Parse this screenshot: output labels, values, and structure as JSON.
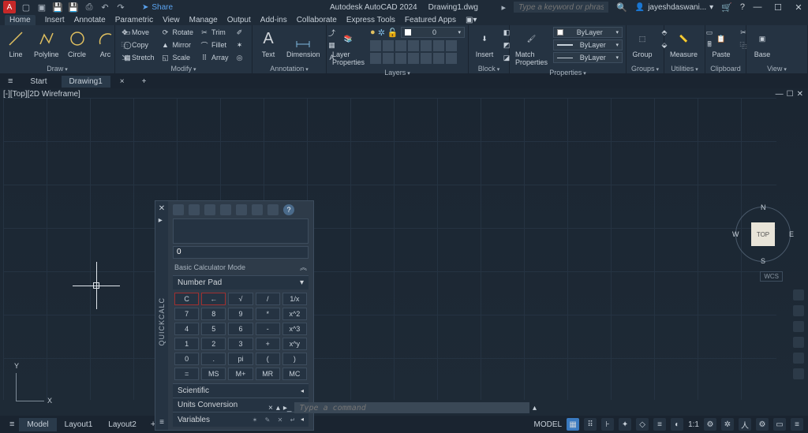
{
  "title": {
    "app": "Autodesk AutoCAD 2024",
    "file": "Drawing1.dwg"
  },
  "qat_share": "Share",
  "search_placeholder": "Type a keyword or phrase",
  "user": "jayeshdaswani...",
  "menu_tabs": [
    "Home",
    "Insert",
    "Annotate",
    "Parametric",
    "View",
    "Manage",
    "Output",
    "Add-ins",
    "Collaborate",
    "Express Tools",
    "Featured Apps"
  ],
  "ribbon": {
    "draw": {
      "label": "Draw",
      "line": "Line",
      "polyline": "Polyline",
      "circle": "Circle",
      "arc": "Arc"
    },
    "modify": {
      "label": "Modify",
      "move": "Move",
      "copy": "Copy",
      "stretch": "Stretch",
      "rotate": "Rotate",
      "mirror": "Mirror",
      "scale": "Scale",
      "trim": "Trim",
      "fillet": "Fillet",
      "array": "Array"
    },
    "annotation": {
      "label": "Annotation",
      "text": "Text",
      "dimension": "Dimension"
    },
    "layers": {
      "label": "Layers",
      "props": "Layer\nProperties",
      "layer0": "0"
    },
    "block": {
      "label": "Block",
      "insert": "Insert"
    },
    "properties": {
      "label": "Properties",
      "match": "Match\nProperties",
      "bylayer": "ByLayer"
    },
    "groups": {
      "label": "Groups",
      "group": "Group"
    },
    "utilities": {
      "label": "Utilities",
      "measure": "Measure"
    },
    "clipboard": {
      "label": "Clipboard",
      "paste": "Paste"
    },
    "view": {
      "label": "View",
      "base": "Base"
    }
  },
  "doc_tabs": {
    "start": "Start",
    "drawing": "Drawing1"
  },
  "viewport": {
    "label": "[-][Top][2D Wireframe]",
    "cube_face": "TOP",
    "cube_n": "N",
    "cube_s": "S",
    "cube_e": "E",
    "cube_w": "W",
    "wcs": "WCS",
    "ucs_x": "X",
    "ucs_y": "Y"
  },
  "quickcalc": {
    "title": "QUICKCALC",
    "result": "0",
    "mode": "Basic Calculator Mode",
    "section_numpad": "Number Pad",
    "section_sci": "Scientific",
    "section_units": "Units Conversion",
    "section_vars": "Variables",
    "keys": [
      "C",
      "←",
      "√",
      "/",
      "1/x",
      "7",
      "8",
      "9",
      "*",
      "x^2",
      "4",
      "5",
      "6",
      "-",
      "x^3",
      "1",
      "2",
      "3",
      "+",
      "x^y",
      "0",
      ".",
      "pi",
      "(",
      ")",
      "=",
      "MS",
      "M+",
      "MR",
      "MC"
    ]
  },
  "cmd_placeholder": "Type a command",
  "bottom_tabs": {
    "model": "Model",
    "l1": "Layout1",
    "l2": "Layout2"
  },
  "status": {
    "model": "MODEL",
    "ratio": "1:1"
  }
}
